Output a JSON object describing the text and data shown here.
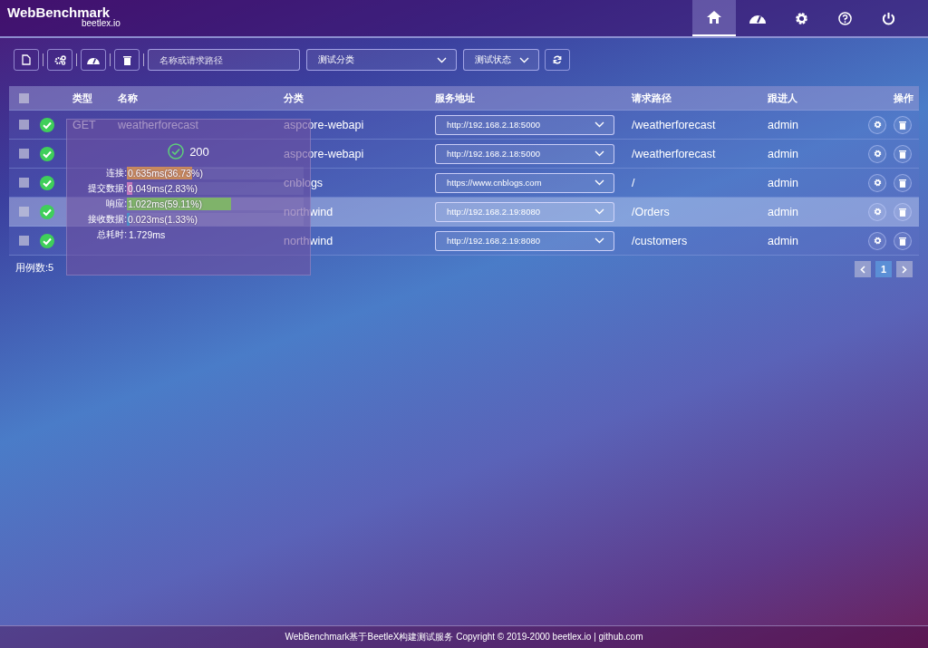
{
  "header": {
    "logo": "WebBenchmark",
    "subtitle": "beetlex.io",
    "nav": [
      {
        "selected": true
      },
      {
        "selected": false
      },
      {
        "selected": false
      },
      {
        "selected": false
      },
      {
        "selected": false
      }
    ]
  },
  "toolbar": {
    "search": {
      "placeholder": "名称或请求路径"
    },
    "category": {
      "placeholder": "测试分类"
    },
    "status": {
      "placeholder": "测试状态"
    }
  },
  "table": {
    "select_all": {
      "checked": false
    },
    "columns": [
      "类型",
      "名称",
      "分类",
      "服务地址",
      "请求路径",
      "跟进人",
      "操作"
    ],
    "rows": [
      {
        "checked": false,
        "selected": false,
        "type": "GET",
        "name": "weatherforecast",
        "category": "aspcore-webapi",
        "server": "http://192.168.2.18:5000",
        "path": "/weatherforecast",
        "owner": "admin"
      },
      {
        "checked": false,
        "selected": false,
        "category": "aspcore-webapi",
        "server": "http://192.168.2.18:5000",
        "path": "/weatherforecast",
        "owner": "admin"
      },
      {
        "checked": false,
        "selected": false,
        "category": "cnblogs",
        "server": "https://www.cnblogs.com",
        "path": "/",
        "owner": "admin"
      },
      {
        "checked": false,
        "selected": true,
        "category": "northwind",
        "server": "http://192.168.2.19:8080",
        "path": "/Orders",
        "owner": "admin"
      },
      {
        "checked": false,
        "selected": false,
        "category": "northwind",
        "server": "http://192.168.2.19:8080",
        "path": "/customers",
        "owner": "admin"
      }
    ],
    "count": "用例数:5",
    "pages": [
      {
        "label": "1",
        "selected": true
      }
    ]
  },
  "tooltip": {
    "code": "200",
    "timings": [
      {
        "label": "连接:",
        "value": "0.635ms(36.73%)",
        "level": 0.3673,
        "color": "#c98a5e"
      },
      {
        "label": "提交数据:",
        "value": "0.049ms(2.83%)",
        "level": 0.0283,
        "color": "#c77ac0"
      },
      {
        "label": "响应:",
        "value": "1.022ms(59.11%)",
        "level": 0.5911,
        "color": "#7fb36a"
      },
      {
        "label": "接收数据:",
        "value": "0.023ms(1.33%)",
        "level": 0.0133,
        "color": "#4c8fc9"
      }
    ],
    "total_label": "总耗时:",
    "total": "1.729ms"
  },
  "footer": "WebBenchmark基于BeetleX构建测试服务 Copyright © 2019-2000 beetlex.io | github.com"
}
